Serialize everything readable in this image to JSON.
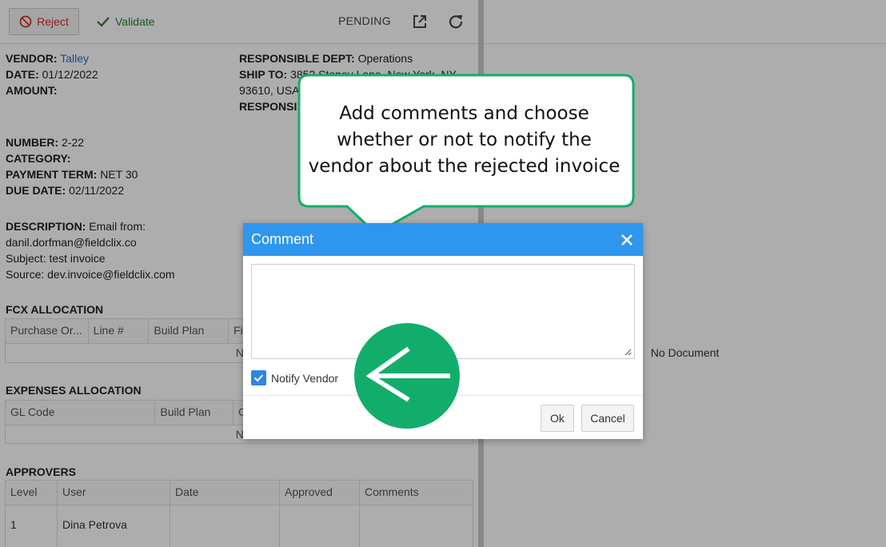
{
  "toolbar": {
    "reject_label": "Reject",
    "validate_label": "Validate",
    "status": "PENDING"
  },
  "invoice": {
    "vendor_label": "VENDOR:",
    "vendor_value": "Talley",
    "date_label": "DATE:",
    "date_value": "01/12/2022",
    "amount_label": "AMOUNT:",
    "dept_label": "RESPONSIBLE DEPT:",
    "dept_value": "Operations",
    "ship_label": "SHIP TO:",
    "ship_value_line1": "3852 Stoney Lane, New York, NY",
    "ship_value_line2": "93610, USA",
    "responsible_label": "RESPONSI",
    "number_label": "NUMBER:",
    "number_value": "2-22",
    "category_label": "CATEGORY:",
    "payment_term_label": "PAYMENT TERM:",
    "payment_term_value": "NET 30",
    "due_date_label": "DUE DATE:",
    "due_date_value": "02/11/2022",
    "description_label": "DESCRIPTION:",
    "description_line1": "Email from:",
    "description_line2": "danil.dorfman@fieldclix.co",
    "description_line3": "Subject: test invoice",
    "description_line4": "Source: dev.invoice@fieldclix.com"
  },
  "fcx_allocation": {
    "title": "FCX ALLOCATION",
    "columns": [
      "Purchase Or...",
      "Line #",
      "Build Plan",
      "Fi"
    ],
    "empty_text": "No records"
  },
  "expenses_allocation": {
    "title": "EXPENSES ALLOCATION",
    "columns": [
      "GL Code",
      "Build Plan",
      "C"
    ],
    "empty_text": "No records"
  },
  "approvers": {
    "title": "APPROVERS",
    "columns": [
      "Level",
      "User",
      "Date",
      "Approved",
      "Comments"
    ],
    "rows": [
      [
        "1",
        "Dina Petrova",
        "",
        "",
        ""
      ]
    ]
  },
  "document_viewer": {
    "empty_text": "No Document"
  },
  "dialog": {
    "title": "Comment",
    "comment_value": "",
    "notify_label": "Notify Vendor",
    "notify_checked": true,
    "ok_label": "Ok",
    "cancel_label": "Cancel"
  },
  "callout": {
    "line1": "Add comments and choose",
    "line2": "whether or not to notify the",
    "line3": "vendor about the rejected invoice",
    "border_color": "#13ad6b"
  },
  "colors": {
    "dialog_header": "#2f96ee",
    "reject": "#d0312d",
    "validate": "#2e7d32",
    "link": "#2a6bc7",
    "arrow_circle": "#13ad6b"
  }
}
